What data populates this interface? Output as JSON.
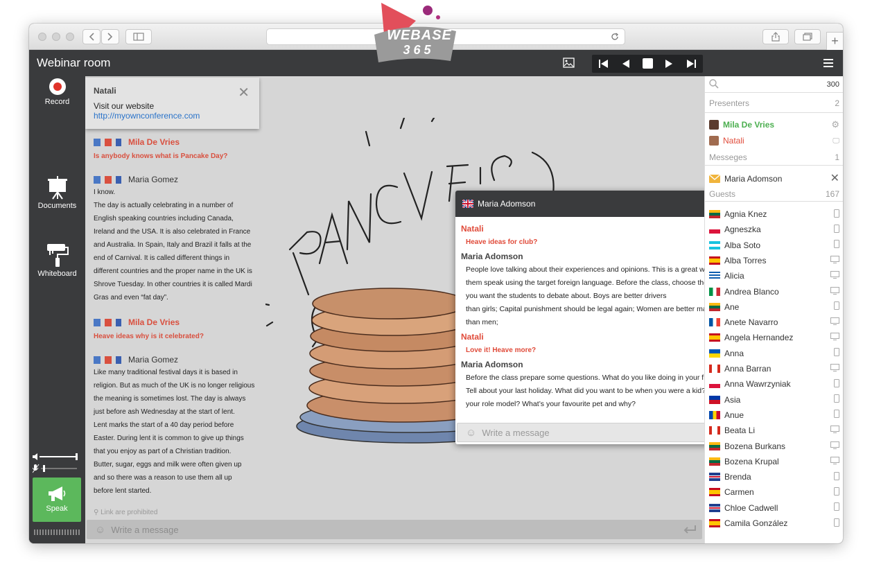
{
  "app": {
    "title": "Webinar room",
    "brand_line1": "WEBASE",
    "brand_line2": "365"
  },
  "browser": {
    "url": ""
  },
  "toolbar": {
    "tools": [
      {
        "label": "Record",
        "icon": "record-icon"
      },
      {
        "label": "Documents",
        "icon": "easel-icon"
      },
      {
        "label": "Whiteboard",
        "icon": "paint-roller-icon"
      }
    ],
    "speak_label": "Speak"
  },
  "notice": {
    "author": "Natali",
    "text": "Visit our website",
    "link": "http://myownconference.com"
  },
  "chat": {
    "messages": [
      {
        "author": "Mila De Vries",
        "role": "presenter",
        "lines": [
          "Is anybody knows what is Pancake Day?"
        ]
      },
      {
        "author": "Maria Gomez",
        "role": "guest",
        "lines": [
          "I know.",
          "The day is actually celebrating in a number of",
          "English speaking countries including Canada,",
          "Ireland and the USA. It is also celebrated in France",
          "and Australia. In Spain, Italy and Brazil it falls at the",
          "end of Carnival.  It is called different things in",
          "different countries and the proper name in the UK is",
          "Shrove Tuesday. In other countries it is called Mardi",
          "Gras and even “fat day”."
        ]
      },
      {
        "author": "Mila De Vries",
        "role": "presenter",
        "lines": [
          "Heave ideas why is it celebrated?"
        ]
      },
      {
        "author": "Maria Gomez",
        "role": "guest",
        "lines": [
          "Like many traditional festival days it is based in",
          "religion. But as much of the UK is no longer religious",
          "the meaning is sometimes lost. The day is always",
          "just before ash Wednesday at the start of lent.",
          "Lent marks the start of a 40 day period before",
          "Easter. During lent it is common to give up things",
          "that you enjoy as part of a Christian tradition.",
          "Butter, sugar, eggs and milk were often given up",
          "and so there was a reason to use them all up",
          "before lent started."
        ]
      }
    ],
    "links_note": "Link are prohibited",
    "input_placeholder": "Write a message"
  },
  "private_chat": {
    "title": "Maria Adomson",
    "input_placeholder": "Write a message",
    "messages": [
      {
        "author": "Natali",
        "kind": "natali",
        "lines": [
          "Heave ideas for club?"
        ]
      },
      {
        "author": "Maria Adomson",
        "kind": "maria",
        "lines": [
          "People love talking about their experiences and opinions. This is a great way to get",
          "them speak using the target foreign language. Before the class, choose the topics",
          "you want the students to debate about. Boys are better drivers",
          "than girls; Capital punishment should be legal again; Women are better managers",
          "than men;"
        ]
      },
      {
        "author": "Natali",
        "kind": "natali",
        "lines": [
          "Love it! Heave more?"
        ]
      },
      {
        "author": "Maria Adomson",
        "kind": "maria",
        "lines": [
          "Before the class prepare some questions. What do you like doing in your free time?",
          "Tell about your last holiday. What did you want to be when you were a kid? Who is",
          "your role model? What’s your favourite pet and why?"
        ]
      }
    ]
  },
  "participants": {
    "total": "300",
    "presenters_label": "Presenters",
    "presenters_count": "2",
    "presenters": [
      {
        "name": "Mila De Vries",
        "color": "#4caf50"
      },
      {
        "name": "Natali",
        "color": "#e04b3a"
      }
    ],
    "messages_label": "Messeges",
    "messages_count": "1",
    "message_from": "Maria Adomson",
    "guests_label": "Guests",
    "guests_count": "167",
    "guests": [
      {
        "name": "Agnia Knez",
        "flag": "lt",
        "device": "mobile"
      },
      {
        "name": "Agneszka",
        "flag": "pl",
        "device": "mobile"
      },
      {
        "name": "Alba Soto",
        "flag": "hn",
        "device": "mobile"
      },
      {
        "name": "Alba Torres",
        "flag": "es",
        "device": "desktop"
      },
      {
        "name": "Alicia",
        "flag": "gr",
        "device": "desktop"
      },
      {
        "name": "Andrea Blanco",
        "flag": "it",
        "device": "desktop"
      },
      {
        "name": "Ane",
        "flag": "lt",
        "device": "mobile"
      },
      {
        "name": "Anete Navarro",
        "flag": "fr",
        "device": "desktop"
      },
      {
        "name": "Angela Hernandez",
        "flag": "es",
        "device": "desktop"
      },
      {
        "name": "Anna",
        "flag": "ua",
        "device": "mobile"
      },
      {
        "name": "Anna Barran",
        "flag": "ca",
        "device": "desktop"
      },
      {
        "name": "Anna Wawrzyniak",
        "flag": "pl",
        "device": "mobile"
      },
      {
        "name": "Asia",
        "flag": "ph",
        "device": "mobile"
      },
      {
        "name": "Anue",
        "flag": "md",
        "device": "mobile"
      },
      {
        "name": "Beata Li",
        "flag": "ca",
        "device": "desktop"
      },
      {
        "name": "Bozena Burkans",
        "flag": "lt",
        "device": "desktop"
      },
      {
        "name": "Bozena Krupal",
        "flag": "lt",
        "device": "desktop"
      },
      {
        "name": "Brenda",
        "flag": "gb",
        "device": "mobile"
      },
      {
        "name": "Carmen",
        "flag": "es",
        "device": "mobile"
      },
      {
        "name": "Chloe Cadwell",
        "flag": "gb",
        "device": "mobile"
      },
      {
        "name": "Camila González",
        "flag": "es",
        "device": "mobile"
      }
    ]
  },
  "colors": {
    "accent_red": "#e04b3a",
    "presenter_green": "#4caf50",
    "speak_green": "#5cb85c",
    "dark_bar": "#3a3b3d"
  }
}
